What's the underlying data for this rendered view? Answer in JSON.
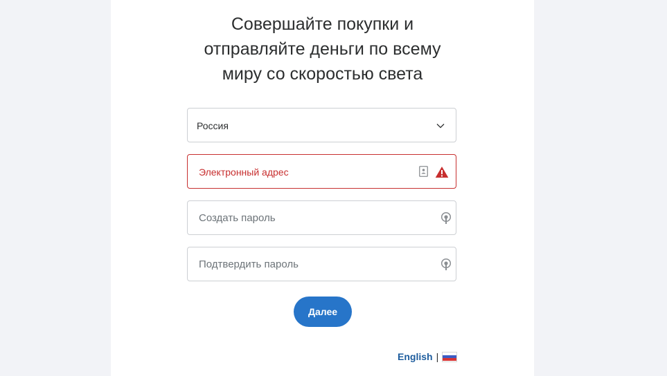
{
  "headline": "Совершайте покупки и\nотправляйте деньги по всему\nмиру со скоростью света",
  "country_select": {
    "value": "Россия",
    "icon": "chevron-down-icon"
  },
  "email_field": {
    "placeholder": "Электронный адрес",
    "state": "error",
    "icons": [
      "contact-card-icon",
      "warning-icon"
    ]
  },
  "password_field": {
    "placeholder": "Создать пароль",
    "icon": "key-icon"
  },
  "confirm_password_field": {
    "placeholder": "Подтвердить пароль",
    "icon": "key-icon"
  },
  "next_button": {
    "label": "Далее"
  },
  "language": {
    "english_label": "English",
    "separator": "|",
    "current_flag": "russia-flag-icon"
  },
  "colors": {
    "accent": "#2775c9",
    "error": "#c72e2e",
    "link": "#1e5d9e",
    "page_bg": "#f2f3f7",
    "card_bg": "#ffffff"
  }
}
